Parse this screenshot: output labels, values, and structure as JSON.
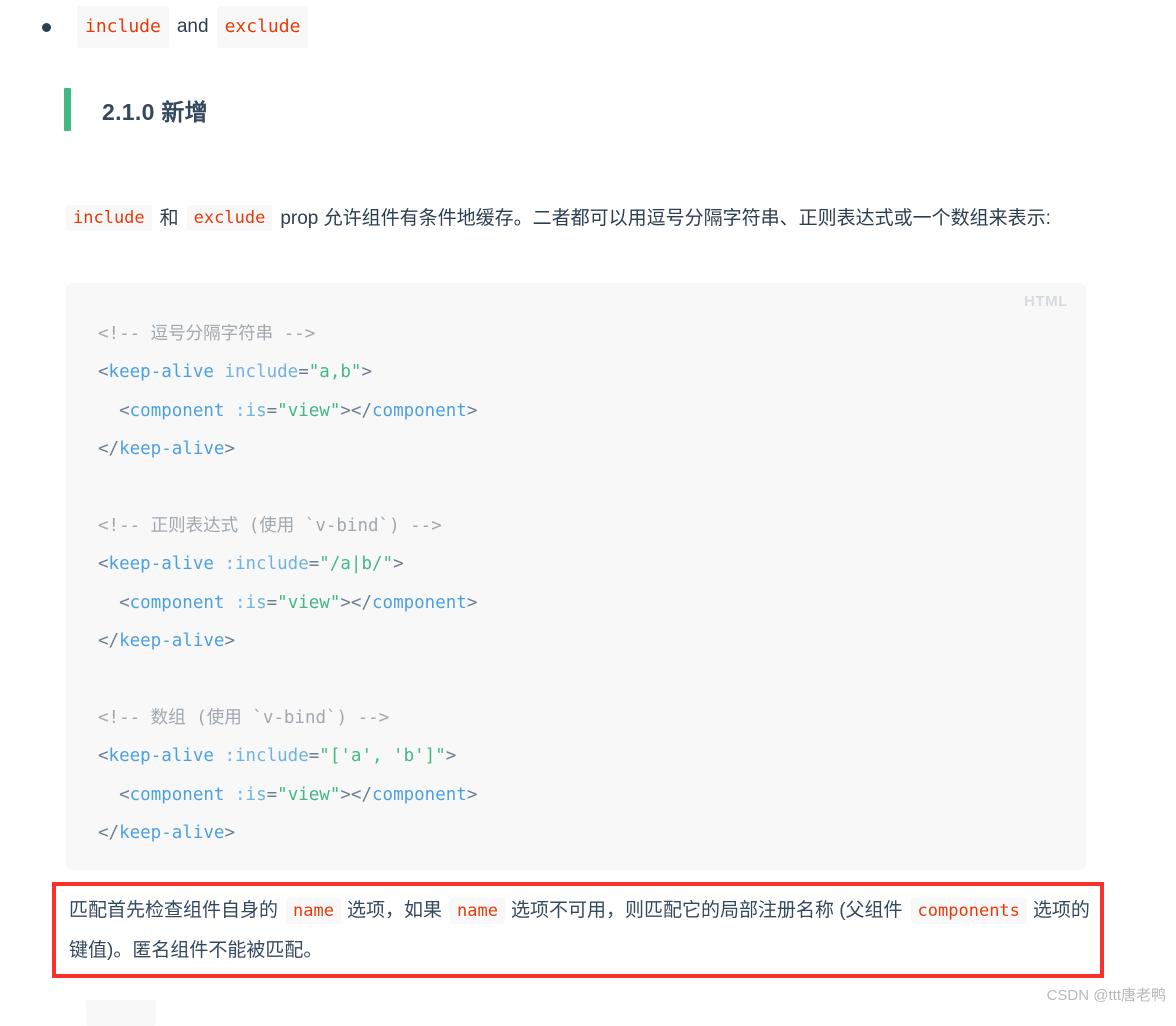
{
  "bullet_item": {
    "code_left": "include",
    "conjunction": "and",
    "code_right": "exclude"
  },
  "heading": {
    "text": "2.1.0 新增",
    "accent_color": "#42b983"
  },
  "paragraph": {
    "code_1": "include",
    "between": "和",
    "code_2": "exclude",
    "rest": "prop 允许组件有条件地缓存。二者都可以用逗号分隔字符串、正则表达式或一个数组来表示:"
  },
  "code_block": {
    "language_label": "HTML",
    "lines": [
      {
        "tokens": [
          {
            "t": "comment",
            "v": "<!-- 逗号分隔字符串 -->"
          }
        ]
      },
      {
        "tokens": [
          {
            "t": "punct",
            "v": "<"
          },
          {
            "t": "tag",
            "v": "keep-alive"
          },
          {
            "t": "plain",
            "v": " "
          },
          {
            "t": "attr",
            "v": "include"
          },
          {
            "t": "punct",
            "v": "="
          },
          {
            "t": "string",
            "v": "\"a,b\""
          },
          {
            "t": "punct",
            "v": ">"
          }
        ]
      },
      {
        "tokens": [
          {
            "t": "plain",
            "v": "  "
          },
          {
            "t": "punct",
            "v": "<"
          },
          {
            "t": "tag",
            "v": "component"
          },
          {
            "t": "plain",
            "v": " "
          },
          {
            "t": "attr",
            "v": ":is"
          },
          {
            "t": "punct",
            "v": "="
          },
          {
            "t": "string",
            "v": "\"view\""
          },
          {
            "t": "punct",
            "v": ">"
          },
          {
            "t": "punct",
            "v": "</"
          },
          {
            "t": "tag",
            "v": "component"
          },
          {
            "t": "punct",
            "v": ">"
          }
        ]
      },
      {
        "tokens": [
          {
            "t": "punct",
            "v": "</"
          },
          {
            "t": "tag",
            "v": "keep-alive"
          },
          {
            "t": "punct",
            "v": ">"
          }
        ]
      },
      {
        "tokens": []
      },
      {
        "tokens": [
          {
            "t": "comment",
            "v": "<!-- 正则表达式 (使用 `v-bind`) -->"
          }
        ]
      },
      {
        "tokens": [
          {
            "t": "punct",
            "v": "<"
          },
          {
            "t": "tag",
            "v": "keep-alive"
          },
          {
            "t": "plain",
            "v": " "
          },
          {
            "t": "attr",
            "v": ":include"
          },
          {
            "t": "punct",
            "v": "="
          },
          {
            "t": "string",
            "v": "\"/a|b/\""
          },
          {
            "t": "punct",
            "v": ">"
          }
        ]
      },
      {
        "tokens": [
          {
            "t": "plain",
            "v": "  "
          },
          {
            "t": "punct",
            "v": "<"
          },
          {
            "t": "tag",
            "v": "component"
          },
          {
            "t": "plain",
            "v": " "
          },
          {
            "t": "attr",
            "v": ":is"
          },
          {
            "t": "punct",
            "v": "="
          },
          {
            "t": "string",
            "v": "\"view\""
          },
          {
            "t": "punct",
            "v": ">"
          },
          {
            "t": "punct",
            "v": "</"
          },
          {
            "t": "tag",
            "v": "component"
          },
          {
            "t": "punct",
            "v": ">"
          }
        ]
      },
      {
        "tokens": [
          {
            "t": "punct",
            "v": "</"
          },
          {
            "t": "tag",
            "v": "keep-alive"
          },
          {
            "t": "punct",
            "v": ">"
          }
        ]
      },
      {
        "tokens": []
      },
      {
        "tokens": [
          {
            "t": "comment",
            "v": "<!-- 数组 (使用 `v-bind`) -->"
          }
        ]
      },
      {
        "tokens": [
          {
            "t": "punct",
            "v": "<"
          },
          {
            "t": "tag",
            "v": "keep-alive"
          },
          {
            "t": "plain",
            "v": " "
          },
          {
            "t": "attr",
            "v": ":include"
          },
          {
            "t": "punct",
            "v": "="
          },
          {
            "t": "string",
            "v": "\"['a', 'b']\""
          },
          {
            "t": "punct",
            "v": ">"
          }
        ]
      },
      {
        "tokens": [
          {
            "t": "plain",
            "v": "  "
          },
          {
            "t": "punct",
            "v": "<"
          },
          {
            "t": "tag",
            "v": "component"
          },
          {
            "t": "plain",
            "v": " "
          },
          {
            "t": "attr",
            "v": ":is"
          },
          {
            "t": "punct",
            "v": "="
          },
          {
            "t": "string",
            "v": "\"view\""
          },
          {
            "t": "punct",
            "v": ">"
          },
          {
            "t": "punct",
            "v": "</"
          },
          {
            "t": "tag",
            "v": "component"
          },
          {
            "t": "punct",
            "v": ">"
          }
        ]
      },
      {
        "tokens": [
          {
            "t": "punct",
            "v": "</"
          },
          {
            "t": "tag",
            "v": "keep-alive"
          },
          {
            "t": "punct",
            "v": ">"
          }
        ]
      }
    ]
  },
  "red_box": {
    "border_color": "#f8312c",
    "seg_1": "匹配首先检查组件自身的",
    "code_1": "name",
    "seg_2": "选项，如果",
    "code_2": "name",
    "seg_3": "选项不可用，则匹配它的局部注册名称 (父组件",
    "code_3": "components",
    "seg_4": "选项的键值)。匿名组件不能被匹配。"
  },
  "watermark": {
    "text": "CSDN @ttt唐老鸭"
  }
}
